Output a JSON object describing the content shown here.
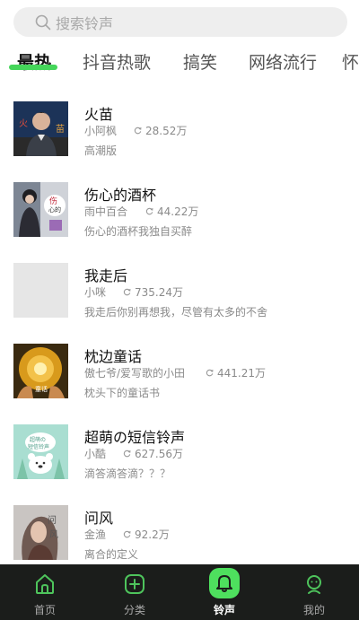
{
  "search": {
    "placeholder": "搜索铃声"
  },
  "tabs": [
    "最热",
    "抖音热歌",
    "搞笑",
    "网络流行",
    "怀"
  ],
  "songs": [
    {
      "title": "火苗",
      "artist": "小阿枫",
      "plays": "28.52万",
      "desc": "高潮版"
    },
    {
      "title": "伤心的酒杯",
      "artist": "雨中百合",
      "plays": "44.22万",
      "desc": "伤心的酒杯我独自买醉"
    },
    {
      "title": "我走后",
      "artist": "小咪",
      "plays": "735.24万",
      "desc": "我走后你别再想我，尽管有太多的不舍"
    },
    {
      "title": "枕边童话",
      "artist": "傲七爷/爱写歌的小田",
      "plays": "441.21万",
      "desc": "枕头下的童话书"
    },
    {
      "title": "超萌の短信铃声",
      "artist": "小酷",
      "plays": "627.56万",
      "desc": "滴答滴答滴？？？"
    },
    {
      "title": "问风",
      "artist": "金渔",
      "plays": "92.2万",
      "desc": "离合的定义"
    }
  ],
  "nav": [
    "首页",
    "分类",
    "铃声",
    "我的"
  ],
  "colors": {
    "accent": "#45d65a",
    "nav_bg": "#1b1d1b"
  }
}
